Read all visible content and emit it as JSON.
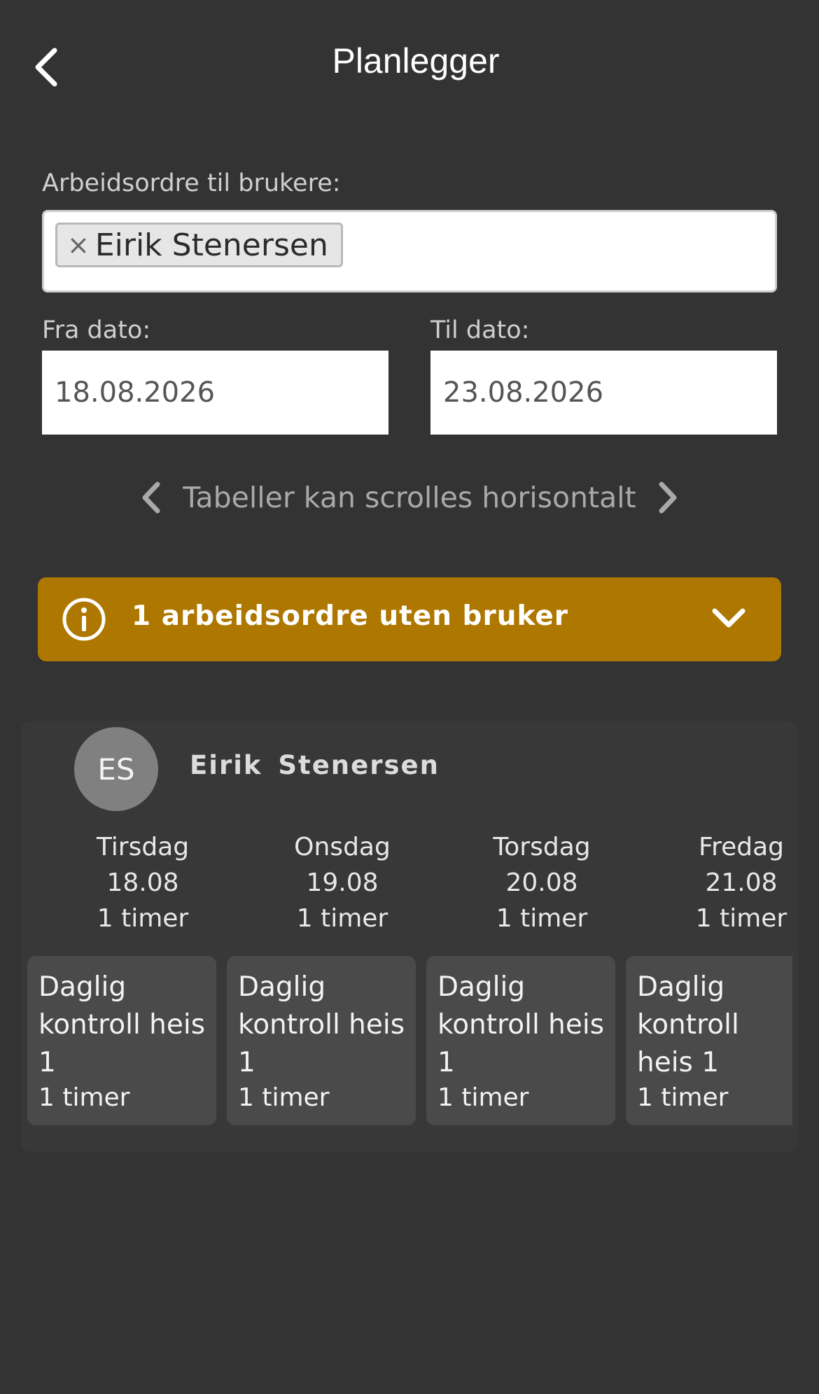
{
  "header": {
    "title": "Planlegger",
    "back_icon": "chevron-left-icon"
  },
  "users_field": {
    "label": "Arbeidsordre til brukere:",
    "selected": [
      {
        "remove": "×",
        "name": "Eirik Stenersen"
      }
    ]
  },
  "from_date": {
    "label": "Fra dato:",
    "value": "18.08.2026"
  },
  "to_date": {
    "label": "Til dato:",
    "value": "23.08.2026"
  },
  "scroll_hint": {
    "text": "Tabeller kan scrolles horisontalt",
    "left_icon": "chevron-left-icon",
    "right_icon": "chevron-right-icon"
  },
  "unassigned_banner": {
    "text": "1 arbeidsordre uten bruker",
    "icon": "info-icon",
    "toggle_icon": "chevron-down-icon",
    "color": "#ad7700"
  },
  "schedule": {
    "user": {
      "initials": "ES",
      "name": "Eirik Stenersen"
    },
    "days": [
      {
        "weekday": "Tirsdag",
        "date": "18.08",
        "hours": "1 timer",
        "task": {
          "name": "Daglig kontroll heis 1",
          "hours": "1 timer"
        }
      },
      {
        "weekday": "Onsdag",
        "date": "19.08",
        "hours": "1 timer",
        "task": {
          "name": "Daglig kontroll heis 1",
          "hours": "1 timer"
        }
      },
      {
        "weekday": "Torsdag",
        "date": "20.08",
        "hours": "1 timer",
        "task": {
          "name": "Daglig kontroll heis 1",
          "hours": "1 timer"
        }
      },
      {
        "weekday": "Fredag",
        "date": "21.08",
        "hours": "1 timer",
        "task": {
          "name": "Daglig kontroll heis 1",
          "hours": "1 timer"
        }
      }
    ]
  },
  "colors": {
    "background": "#333333",
    "card": "#383838",
    "task": "#4a4a4a",
    "avatar": "#808080"
  }
}
